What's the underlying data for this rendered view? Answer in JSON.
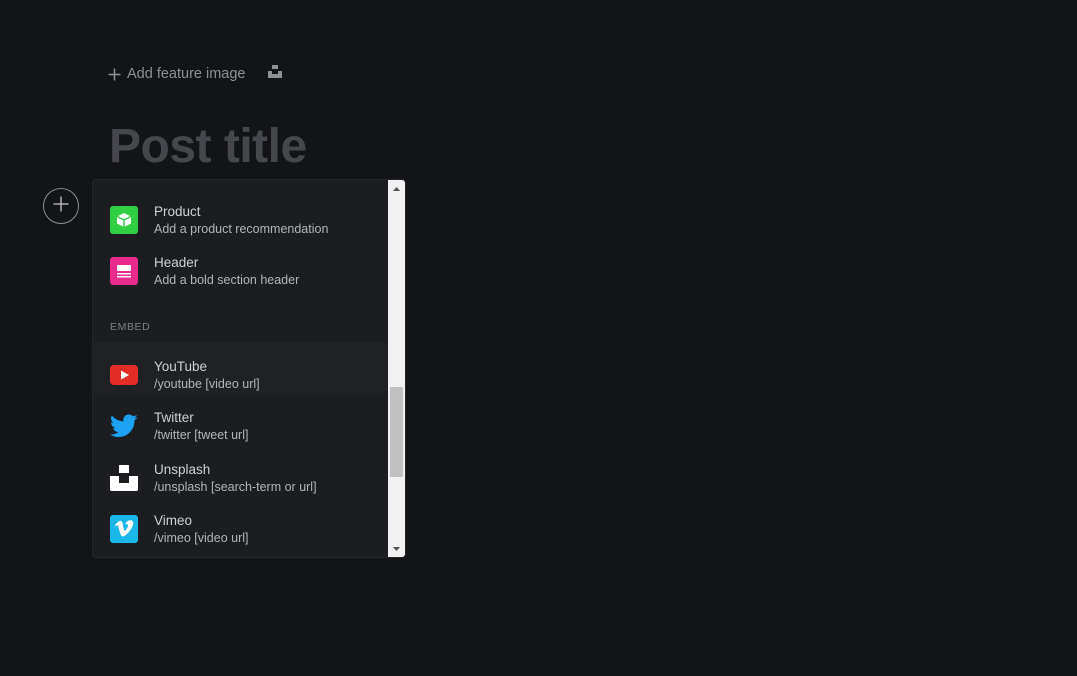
{
  "editor": {
    "add_feature_image": "Add feature image",
    "title_placeholder": "Post title"
  },
  "card_menu": {
    "items_top": [
      {
        "title": "Product",
        "desc": "Add a product recommendation",
        "icon": "product-icon",
        "color": "#30cf43"
      },
      {
        "title": "Header",
        "desc": "Add a bold section header",
        "icon": "header-icon",
        "color": "#e82b8c"
      }
    ],
    "embed_label": "EMBED",
    "embed_items": [
      {
        "title": "YouTube",
        "desc": "/youtube [video url]",
        "icon": "youtube-icon",
        "color": "#e52d27"
      },
      {
        "title": "Twitter",
        "desc": "/twitter [tweet url]",
        "icon": "twitter-icon",
        "color": "#1da1f2"
      },
      {
        "title": "Unsplash",
        "desc": "/unsplash [search-term or url]",
        "icon": "unsplash-icon",
        "color": "#ffffff"
      },
      {
        "title": "Vimeo",
        "desc": "/vimeo [video url]",
        "icon": "vimeo-icon",
        "color": "#1ab7ea"
      }
    ]
  }
}
